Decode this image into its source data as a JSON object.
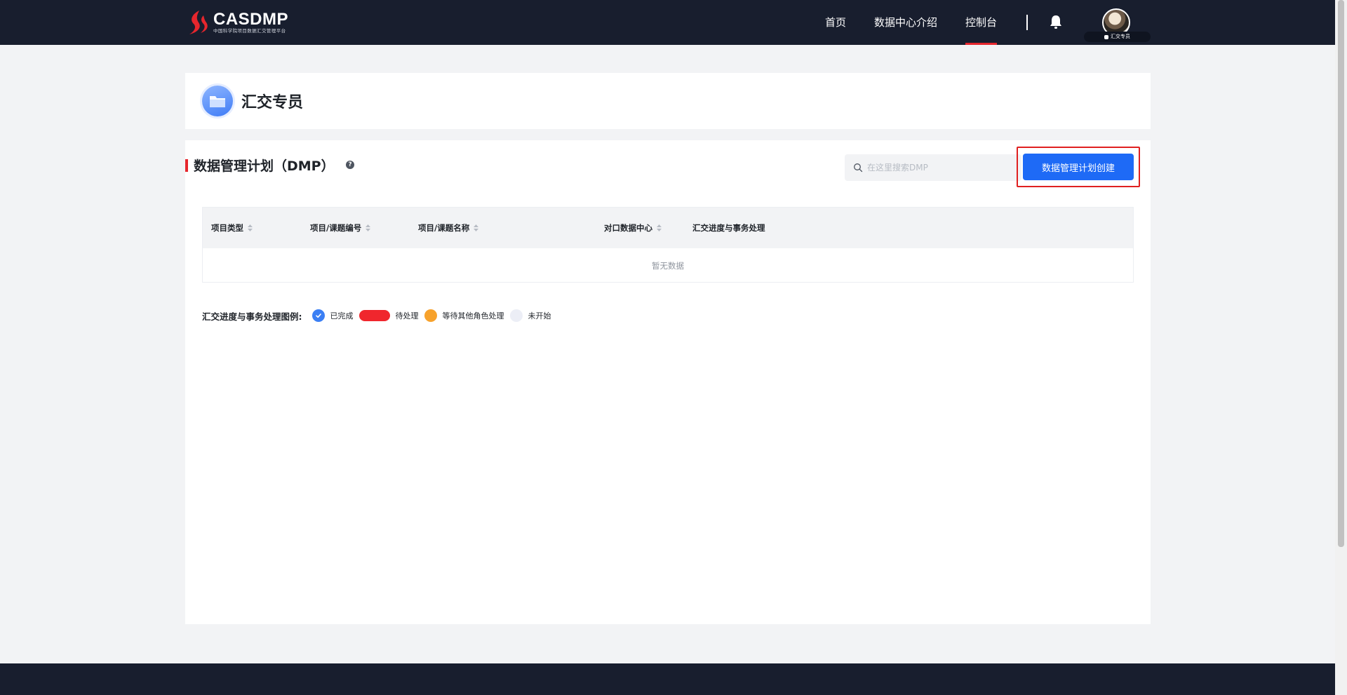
{
  "topbar": {
    "logo": {
      "title": "CASDMP",
      "subtitle": "中国科学院项目数据汇交管理平台"
    },
    "nav": [
      {
        "label": "首页",
        "active": false
      },
      {
        "label": "数据中心介绍",
        "active": false
      },
      {
        "label": "控制台",
        "active": true
      }
    ],
    "user": {
      "role_tag": "汇交专员"
    }
  },
  "header": {
    "title": "汇交专员"
  },
  "main": {
    "section_title": "数据管理计划（DMP）",
    "help_glyph": "?",
    "search": {
      "placeholder": "在这里搜索DMP",
      "value": ""
    },
    "create_button": "数据管理计划创建",
    "table": {
      "columns": [
        "项目类型",
        "项目/课题编号",
        "项目/课题名称",
        "对口数据中心",
        "汇交进度与事务处理"
      ],
      "rows": [],
      "empty_text": "暂无数据"
    },
    "legend": {
      "title": "汇交进度与事务处理图例:",
      "items": [
        {
          "label": "已完成",
          "color": "#3b7ff4"
        },
        {
          "label": "待处理",
          "color": "#f0262d"
        },
        {
          "label": "等待其他角色处理",
          "color": "#f7a22c"
        },
        {
          "label": "未开始",
          "color": "#eceef6"
        }
      ]
    }
  },
  "colors": {
    "nav_bg": "#181e2e",
    "accent_red": "#e6262d",
    "primary_blue": "#1e6af6"
  }
}
